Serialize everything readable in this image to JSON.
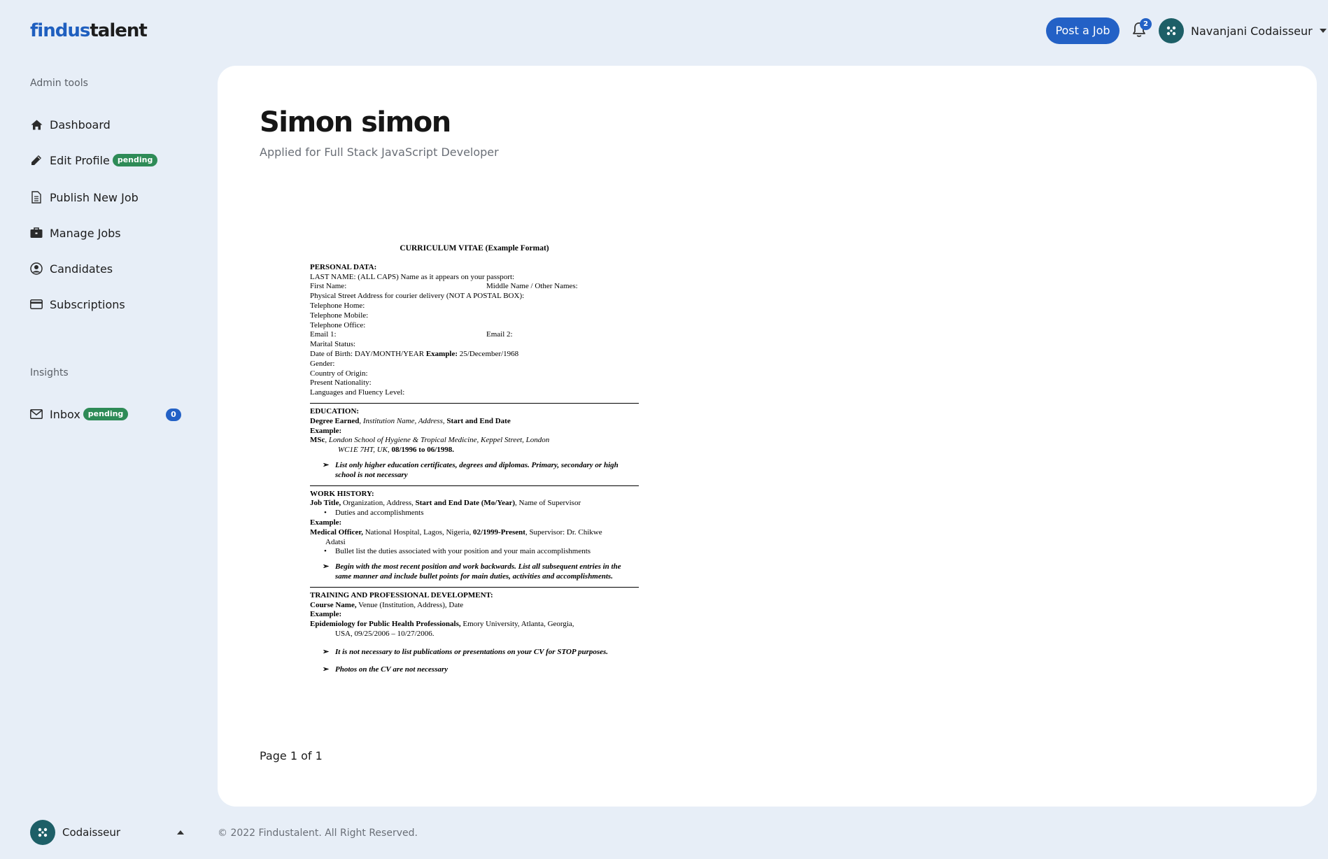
{
  "logo": {
    "part1": "findus",
    "part2": "talent"
  },
  "header": {
    "post_job_label": "Post a Job",
    "notification_count": "2",
    "user_name": "Navanjani Codaisseur"
  },
  "sidebar": {
    "admin_section_label": "Admin tools",
    "items": [
      {
        "label": "Dashboard",
        "icon": "home-icon"
      },
      {
        "label": "Edit Profile",
        "icon": "pencil-icon",
        "badge": "pending"
      },
      {
        "label": "Publish New Job",
        "icon": "document-icon"
      },
      {
        "label": "Manage Jobs",
        "icon": "briefcase-icon"
      },
      {
        "label": "Candidates",
        "icon": "user-circle-icon"
      },
      {
        "label": "Subscriptions",
        "icon": "credit-card-icon"
      }
    ],
    "insights_section_label": "Insights",
    "inbox": {
      "label": "Inbox",
      "badge": "pending",
      "count": "0",
      "icon": "envelope-icon"
    },
    "bottom_user": "Codaisseur"
  },
  "main": {
    "title": "Simon simon",
    "subtitle": "Applied for Full Stack JavaScript Developer",
    "page_indicator": "Page 1 of 1"
  },
  "cv": {
    "title": "CURRICULUM VITAE  (Example Format)",
    "personal_heading": "PERSONAL DATA:",
    "last_name": "LAST NAME: (ALL CAPS) Name as it appears on your passport:",
    "first_name": "First Name:",
    "middle_name": "Middle Name / Other Names:",
    "address": "Physical Street Address for courier delivery (NOT A POSTAL BOX):",
    "tel_home": "Telephone Home:",
    "tel_mobile": "Telephone Mobile:",
    "tel_office": "Telephone Office:",
    "email1": "Email 1:",
    "email2": "Email 2:",
    "marital": "Marital Status:",
    "dob_label": "Date of Birth:   DAY/MONTH/YEAR ",
    "dob_example_label": "Example:",
    "dob_example": " 25/December/1968",
    "gender": "Gender:",
    "country": "Country of Origin:",
    "nationality": "Present Nationality:",
    "languages": "Languages and Fluency Level:",
    "edu_heading": "EDUCATION:",
    "edu_format_b1": "Degree Earned",
    "edu_format_i": "Institution Name, Address",
    "edu_format_b2": "Start and End Date",
    "example_label": "Example:",
    "edu_ex_b": "MSc",
    "edu_ex_i": "London School of Hygiene & Tropical Medicine, Keppel Street, London",
    "edu_ex_i2": "WC1E 7HT, UK",
    "edu_ex_dates": "08/1996 to 06/1998.",
    "edu_note": "List only higher education certificates, degrees and diplomas.  Primary, secondary or high school is not necessary",
    "work_heading": "WORK HISTORY:",
    "work_format_b1": "Job Title,",
    "work_format_n1": " Organization, Address, ",
    "work_format_b2": "Start and End Date (Mo/Year)",
    "work_format_n2": ", Name of Supervisor",
    "work_format_bullet": "Duties and accomplishments",
    "work_ex_b1": "Medical Officer,",
    "work_ex_n1": " National Hospital, Lagos, Nigeria, ",
    "work_ex_b2": "02/1999-Present",
    "work_ex_n2": ", Supervisor:  Dr. Chikwe",
    "work_ex_n3": "Adatsi",
    "work_ex_bullet": "Bullet list the duties associated with your position and your main accomplishments",
    "work_note": "Begin with the most recent position and work backwards.  List all subsequent entries in the same manner and include bullet points for main duties, activities and accomplishments.",
    "training_heading": "TRAINING AND PROFESSIONAL DEVELOPMENT:",
    "training_format_b": "Course Name,",
    "training_format_n": " Venue (Institution, Address), Date",
    "training_ex_b": "Epidemiology for Public Health Professionals,",
    "training_ex_n": " Emory University, Atlanta, Georgia,",
    "training_ex_n2": "USA, 09/25/2006 – 10/27/2006.",
    "note_publications": "It is not necessary to list publications or presentations on your CV for STOP purposes.",
    "note_photos": "Photos on the CV are not necessary"
  },
  "footer": {
    "copyright": "© 2022 Findustalent. All Right Reserved."
  }
}
